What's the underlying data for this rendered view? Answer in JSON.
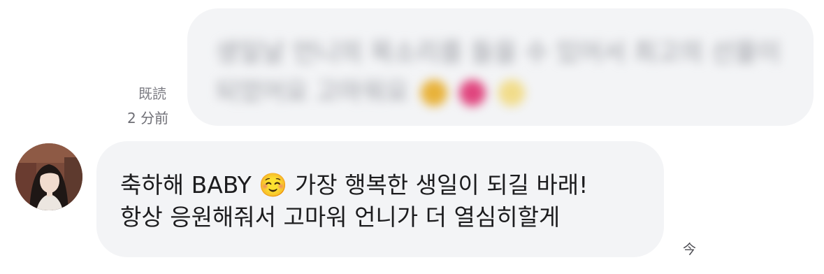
{
  "conversation": {
    "sent_message": {
      "text_line1": "생일날 언니의 목소리를 들을 수 있어서 최고의 선물이",
      "text_line2": "되었어요 고마워요",
      "blurred": true,
      "emojis": [
        "grinning-sweat-emoji",
        "heart-with-ribbon-emoji",
        "sparkles-emoji"
      ],
      "read_status": "既読",
      "timestamp": "2 分前"
    },
    "received_message": {
      "line1_part1": "축하해 BABY",
      "line1_emoji": "☺️",
      "line1_part2": " 가장 행복한 생일이 되길 바래!",
      "line2": "항상 응원해줘서 고마워 언니가 더 열심히할게",
      "timestamp": "今"
    }
  },
  "colors": {
    "bubble_background": "#f3f4f6",
    "message_text": "#1c1c1e",
    "meta_text": "#7d7d84"
  }
}
